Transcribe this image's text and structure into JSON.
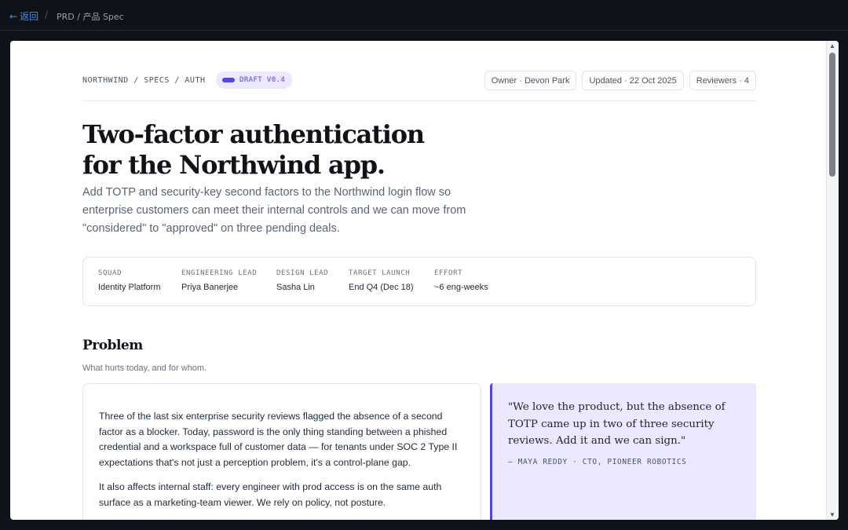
{
  "topbar": {
    "back_arrow": "←",
    "back_label": "返回",
    "separator": "/",
    "title": "PRD / 产品 Spec"
  },
  "doc": {
    "breadcrumb": "NORTHWIND / SPECS / AUTH",
    "status_badge": "DRAFT V0.4",
    "chips": {
      "owner": "Owner · Devon Park",
      "updated": "Updated · 22 Oct 2025",
      "reviewers": "Reviewers · 4"
    },
    "title_line1": "Two-factor authentication",
    "title_line2": "for the Northwind app.",
    "lede": "Add TOTP and security-key second factors to the Northwind login flow so enterprise customers can meet their internal controls and we can move from \"considered\" to \"approved\" on three pending deals.",
    "facts": [
      {
        "label": "SQUAD",
        "value": "Identity Platform"
      },
      {
        "label": "ENGINEERING LEAD",
        "value": "Priya Banerjee"
      },
      {
        "label": "DESIGN LEAD",
        "value": "Sasha Lin"
      },
      {
        "label": "TARGET LAUNCH",
        "value": "End Q4 (Dec 18)"
      },
      {
        "label": "EFFORT",
        "value": "~6 eng-weeks"
      }
    ],
    "problem": {
      "heading": "Problem",
      "subheading": "What hurts today, and for whom.",
      "paragraphs": [
        "Three of the last six enterprise security reviews flagged the absence of a second factor as a blocker. Today, password is the only thing standing between a phished credential and a workspace full of customer data — for tenants under SOC 2 Type II expectations that's not just a perception problem, it's a control-plane gap.",
        "It also affects internal staff: every engineer with prod access is on the same auth surface as a marketing-team viewer. We rely on policy, not posture."
      ],
      "quote": "\"We love the product, but the absence of TOTP came up in two of three security reviews. Add it and we can sign.\"",
      "quote_attribution": "— MAYA REDDY · CTO, PIONEER ROBOTICS"
    }
  },
  "colors": {
    "accent": "#4f46e5",
    "badge_bg": "#ebe8ff",
    "quote_bg": "#ece9ff",
    "topbar_bg": "#0f1218",
    "link": "#4a90e2"
  }
}
